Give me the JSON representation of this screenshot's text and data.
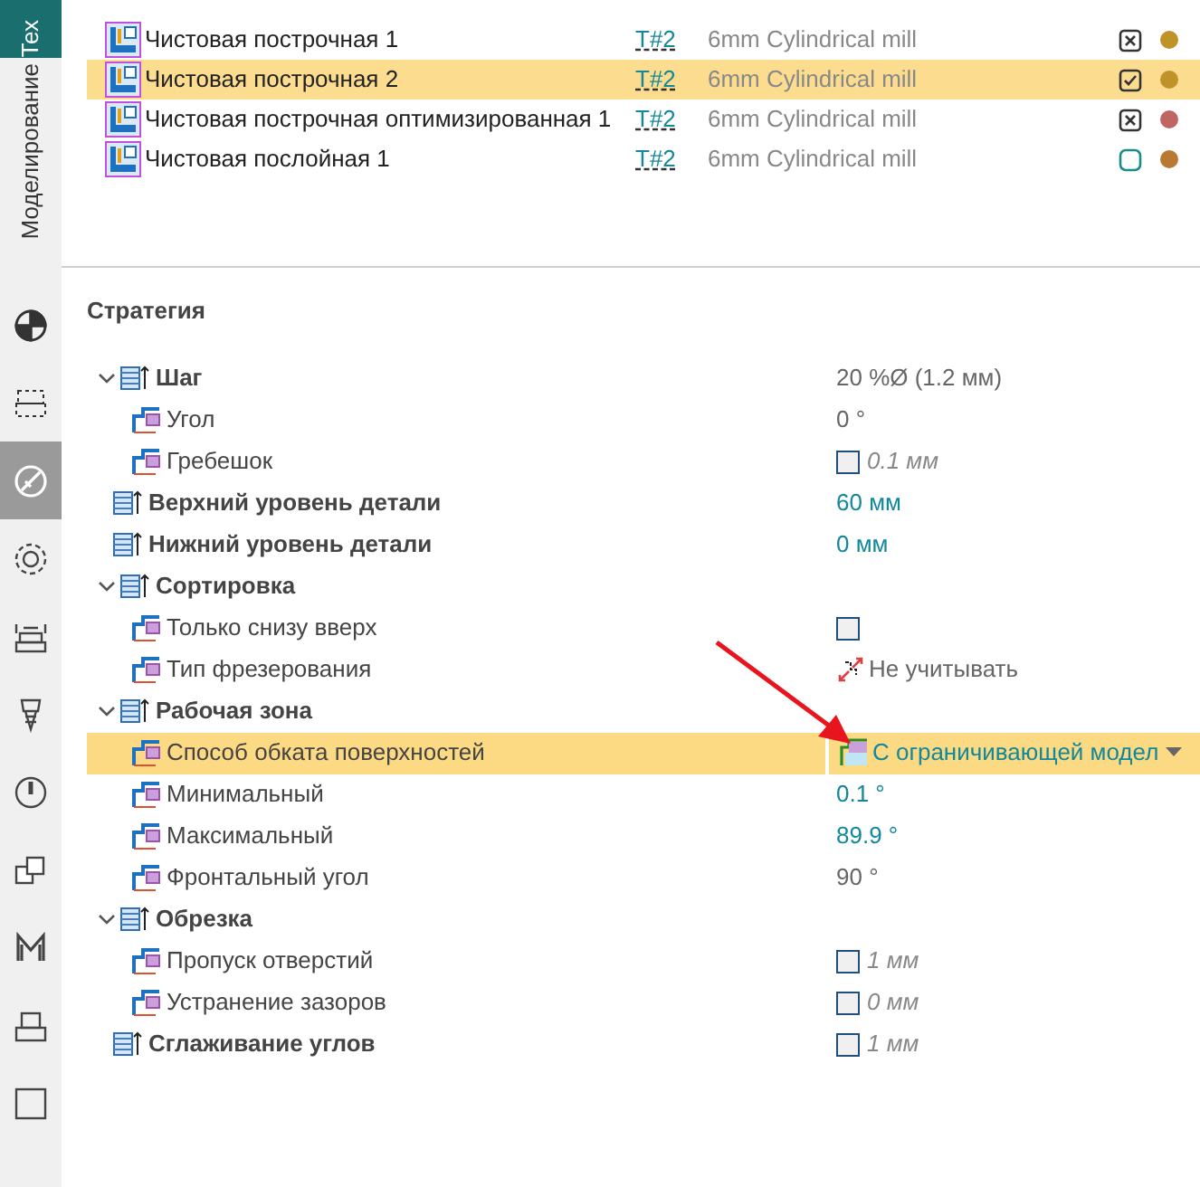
{
  "side_tabs": [
    {
      "label": "Тех",
      "selected": true
    },
    {
      "label": "Моделирование",
      "selected": false
    }
  ],
  "side_tools": [
    {
      "selected": false
    },
    {
      "selected": false
    },
    {
      "selected": true
    },
    {
      "selected": false
    },
    {
      "selected": false
    },
    {
      "selected": false
    },
    {
      "selected": false
    },
    {
      "selected": false
    },
    {
      "selected": false
    },
    {
      "selected": false
    },
    {
      "selected": false
    }
  ],
  "operations": [
    {
      "name": "Чистовая построчная 1",
      "tool_ref": "T#2",
      "tool": "6mm Cylindrical mill",
      "kind": "crossed",
      "color": "#c0922a",
      "selected": false
    },
    {
      "name": "Чистовая построчная 2",
      "tool_ref": "T#2",
      "tool": "6mm Cylindrical mill",
      "kind": "checked",
      "color": "#c0922a",
      "selected": true
    },
    {
      "name": "Чистовая построчная оптимизированная 1",
      "tool_ref": "T#2",
      "tool": "6mm Cylindrical mill",
      "kind": "crossed",
      "color": "#c06464",
      "selected": false
    },
    {
      "name": "Чистовая послойная 1",
      "tool_ref": "T#2",
      "tool": "6mm Cylindrical mill",
      "kind": "empty",
      "color": "#b87a30",
      "selected": false
    }
  ],
  "section_title": "Стратегия",
  "parameters": [
    {
      "label": "Шаг",
      "bold": true,
      "expanded": true,
      "selected": false,
      "value": {
        "kind": "text",
        "text": "20 %Ø (1.2 мм)",
        "modified": false
      },
      "children": [
        {
          "label": "Угол",
          "bold": false,
          "selected": false,
          "value": {
            "kind": "text",
            "text": "0 °",
            "modified": false
          }
        },
        {
          "label": "Гребешок",
          "bold": false,
          "selected": false,
          "value": {
            "kind": "checkbox",
            "checked": false,
            "text": "0.1 мм"
          }
        }
      ]
    },
    {
      "label": "Верхний уровень детали",
      "bold": true,
      "selected": false,
      "value": {
        "kind": "text",
        "text": "60 мм",
        "modified": true
      }
    },
    {
      "label": "Нижний уровень детали",
      "bold": true,
      "selected": false,
      "value": {
        "kind": "text",
        "text": "0 мм",
        "modified": true
      }
    },
    {
      "label": "Сортировка",
      "bold": true,
      "expanded": true,
      "selected": false,
      "children": [
        {
          "label": "Только снизу вверх",
          "bold": false,
          "selected": false,
          "value": {
            "kind": "checkbox",
            "checked": false
          }
        },
        {
          "label": "Тип фрезерования",
          "bold": false,
          "selected": false,
          "value": {
            "kind": "icon_text",
            "text": "Не учитывать",
            "modified": false
          }
        }
      ]
    },
    {
      "label": "Рабочая зона",
      "bold": true,
      "expanded": true,
      "selected": false,
      "children": [
        {
          "label": "Способ обката поверхностей",
          "bold": false,
          "selected": true,
          "value": {
            "kind": "dropdown",
            "text": "С ограничивающей модел",
            "modified": true
          }
        },
        {
          "label": "Минимальный",
          "bold": false,
          "selected": false,
          "value": {
            "kind": "text",
            "text": "0.1 °",
            "modified": true
          }
        },
        {
          "label": "Максимальный",
          "bold": false,
          "selected": false,
          "value": {
            "kind": "text",
            "text": "89.9 °",
            "modified": true
          }
        },
        {
          "label": "Фронтальный угол",
          "bold": false,
          "selected": false,
          "value": {
            "kind": "text",
            "text": "90 °",
            "modified": false
          }
        }
      ]
    },
    {
      "label": "Обрезка",
      "bold": true,
      "expanded": true,
      "selected": false,
      "children": [
        {
          "label": "Пропуск отверстий",
          "bold": false,
          "selected": false,
          "value": {
            "kind": "checkbox",
            "checked": false,
            "text": "1 мм"
          }
        },
        {
          "label": "Устранение зазоров",
          "bold": false,
          "selected": false,
          "value": {
            "kind": "checkbox",
            "checked": false,
            "text": "0 мм"
          }
        }
      ]
    },
    {
      "label": "Сглаживание углов",
      "bold": true,
      "selected": false,
      "value": {
        "kind": "checkbox",
        "checked": false,
        "text": "1 мм"
      }
    }
  ]
}
